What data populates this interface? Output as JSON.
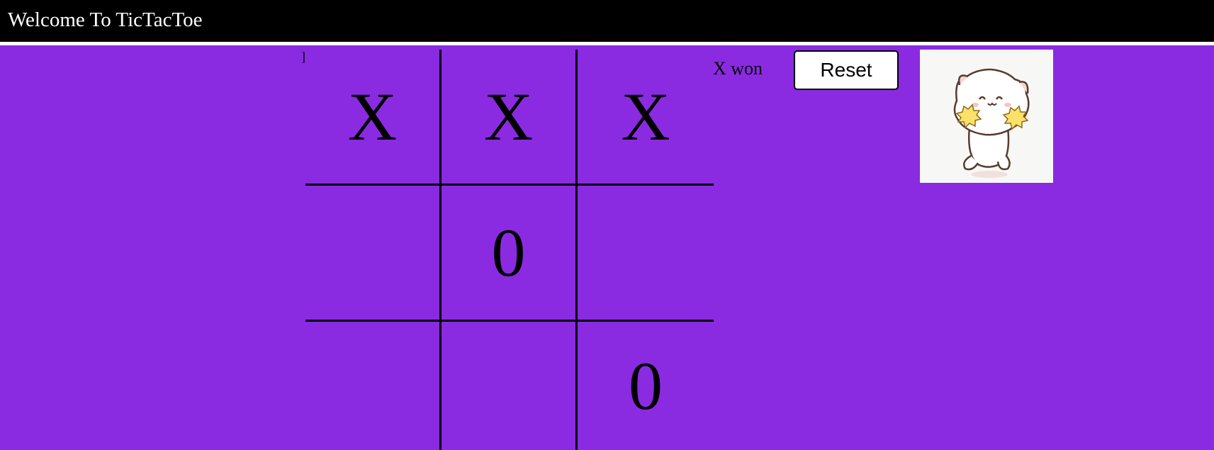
{
  "header": {
    "title": "Welcome To TicTacToe"
  },
  "stray_text": "]",
  "board": {
    "cells": [
      "X",
      "X",
      "X",
      "",
      "0",
      "",
      "",
      "",
      "0"
    ]
  },
  "status": {
    "message": "X won"
  },
  "controls": {
    "reset_label": "Reset"
  },
  "mascot": {
    "icon": "cheering-cat-icon"
  },
  "colors": {
    "background": "#8a2be2",
    "header": "#000000",
    "grid_lines": "#000000"
  }
}
